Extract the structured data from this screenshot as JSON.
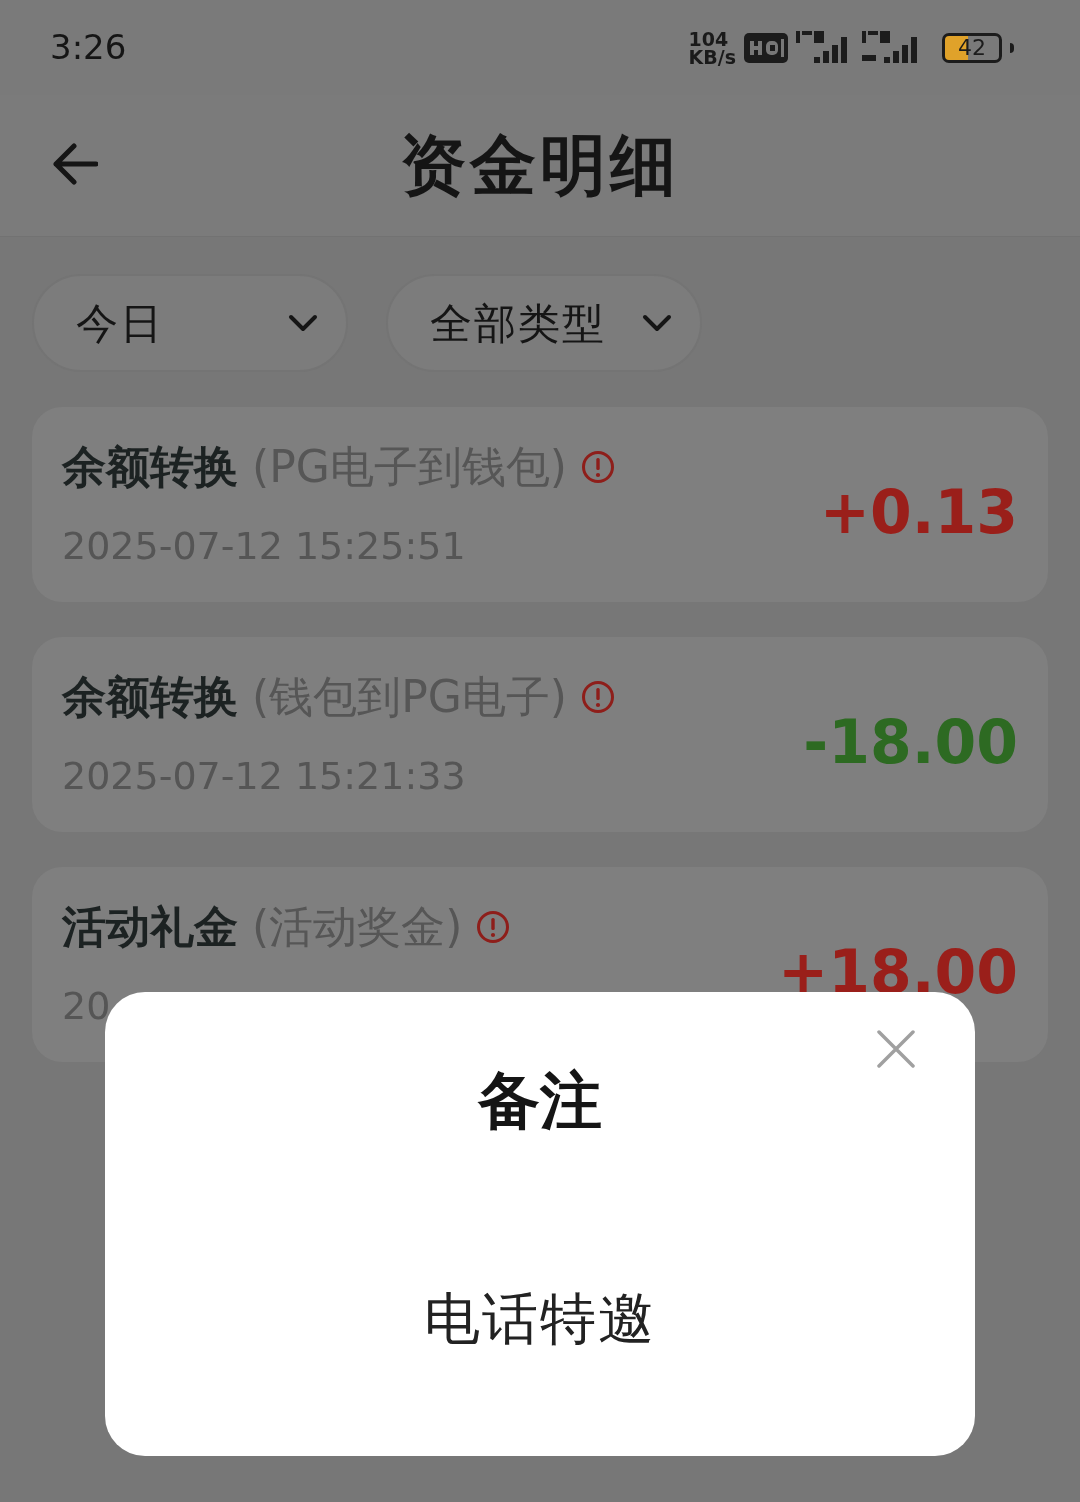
{
  "status_bar": {
    "time": "3:26",
    "speed_value": "104",
    "speed_unit": "KB/s",
    "battery": "42"
  },
  "header": {
    "title": "资金明细"
  },
  "filters": [
    {
      "label": "今日"
    },
    {
      "label": "全部类型"
    }
  ],
  "records": [
    {
      "title": "余额转换",
      "detail": "(PG电子到钱包)",
      "date": "2025-07-12 15:25:51",
      "amount": "+0.13",
      "kind": "income"
    },
    {
      "title": "余额转换",
      "detail": "(钱包到PG电子)",
      "date": "2025-07-12 15:21:33",
      "amount": "-18.00",
      "kind": "expense"
    },
    {
      "title": "活动礼金",
      "detail": "(活动奖金)",
      "date": "20",
      "amount": "+18.00",
      "kind": "income"
    }
  ],
  "dialog": {
    "title": "备注",
    "message": "电话特邀"
  }
}
